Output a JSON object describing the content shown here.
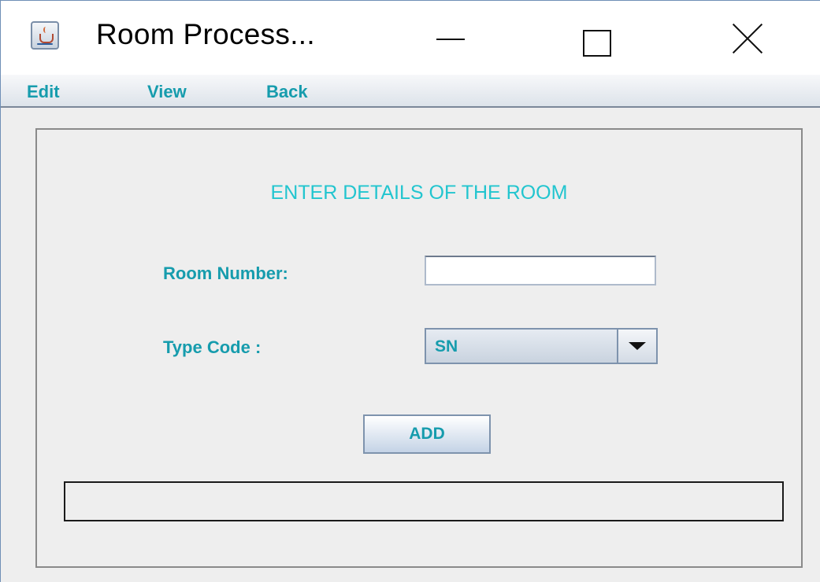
{
  "window": {
    "title": "Room Process..."
  },
  "menu": {
    "items": [
      {
        "label": "Edit"
      },
      {
        "label": "View"
      },
      {
        "label": "Back"
      }
    ]
  },
  "form": {
    "heading": "ENTER DETAILS OF THE ROOM",
    "room_number_label": "Room Number:",
    "room_number_value": "",
    "type_code_label": "Type Code :",
    "type_code_selected": "SN",
    "add_button_label": "ADD",
    "status_text": ""
  },
  "colors": {
    "accent_text": "#169cad",
    "heading_text": "#22c5cf",
    "panel_background": "#eeeeee"
  },
  "icons": {
    "app": "java-coffee-icon",
    "minimize": "minimize-icon",
    "maximize": "maximize-icon",
    "close": "close-icon",
    "dropdown": "chevron-down-icon"
  }
}
